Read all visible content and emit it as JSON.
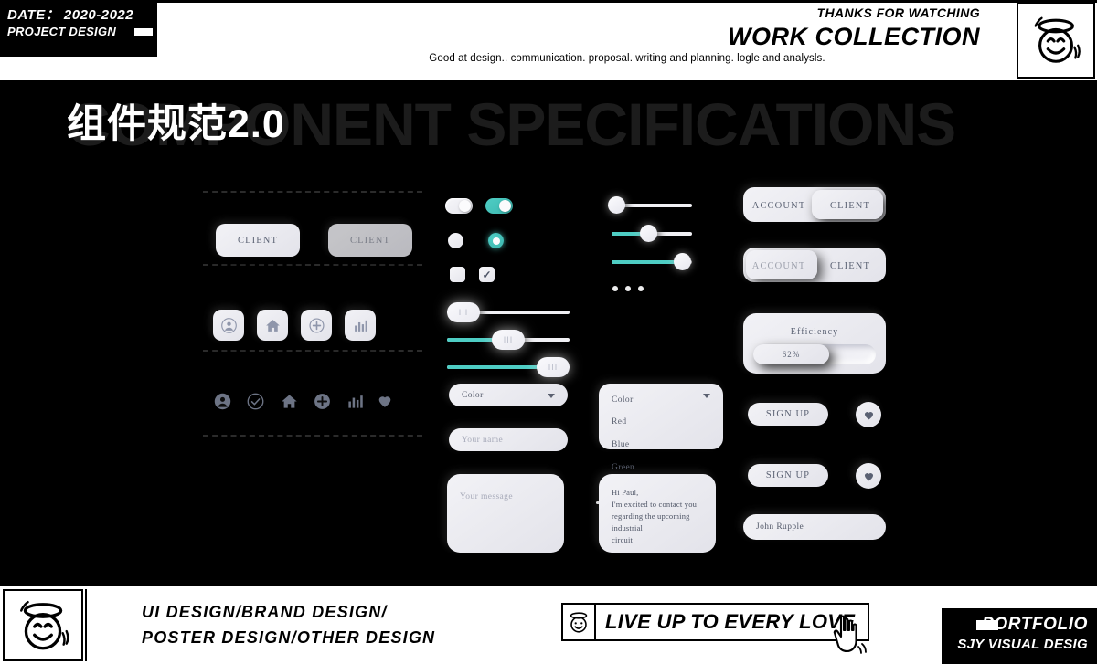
{
  "header": {
    "date_label": "DATE： 2020-2022",
    "project_label": "PROJECT DESIGN",
    "thanks": "THANKS FOR WATCHING",
    "title": "WORK COLLECTION",
    "subtitle": "Good at design..  communication.  proposal.  writing and planning.  logle and analysls.",
    "logo_icon": "angel-smiley-icon"
  },
  "hero": {
    "ghost_title": "COMPONENT SPECIFICATIONS",
    "cn_title": "组件规范2.0"
  },
  "colors": {
    "accent_teal": "#4ECDC4",
    "page_black": "#000000",
    "surface_light": "#ECECF1",
    "text_muted": "#5D6475"
  },
  "components": {
    "client_buttons": [
      {
        "label": "CLIENT",
        "state": "normal"
      },
      {
        "label": "CLIENT",
        "state": "soft"
      }
    ],
    "icon_square_buttons": [
      {
        "icon": "person-icon"
      },
      {
        "icon": "home-icon"
      },
      {
        "icon": "plus-circle-icon"
      },
      {
        "icon": "bar-chart-icon"
      }
    ],
    "plain_icons": [
      {
        "icon": "person-icon"
      },
      {
        "icon": "check-circle-icon"
      },
      {
        "icon": "home-icon"
      },
      {
        "icon": "plus-circle-icon"
      },
      {
        "icon": "bar-chart-icon"
      },
      {
        "icon": "heart-icon"
      }
    ],
    "toggles": [
      {
        "name": "toggle-off",
        "on": false
      },
      {
        "name": "toggle-on",
        "on": true
      }
    ],
    "radios": [
      {
        "name": "radio-off",
        "on": false
      },
      {
        "name": "radio-on",
        "on": true
      }
    ],
    "checkboxes": [
      {
        "name": "checkbox-off",
        "checked": false,
        "glyph": ""
      },
      {
        "name": "checkbox-checked",
        "checked": true,
        "glyph": "✓"
      }
    ],
    "pill_sliders": [
      {
        "value": 0,
        "handle_glyph": "III"
      },
      {
        "value": 50,
        "handle_glyph": "III"
      },
      {
        "value": 90,
        "handle_glyph": "III"
      }
    ],
    "round_sliders": [
      {
        "value": 0
      },
      {
        "value": 45
      },
      {
        "value": 88
      }
    ],
    "pagination_dots": 3,
    "spinners": 2,
    "segmented_controls": [
      {
        "options": [
          "ACCOUNT",
          "CLIENT"
        ],
        "selected": "CLIENT"
      },
      {
        "options": [
          "ACCOUNT",
          "CLIENT"
        ],
        "selected": "ACCOUNT"
      }
    ],
    "efficiency_card": {
      "title": "Efficiency",
      "progress_label": "62%",
      "progress_value": 62
    },
    "dropdown_closed": {
      "value": "Color",
      "caret": "chevron-down-icon"
    },
    "dropdown_open": {
      "value": "Color",
      "options": [
        "Red",
        "Blue",
        "Green"
      ],
      "caret": "chevron-down-icon"
    },
    "name_input": {
      "placeholder": "Your name",
      "value": ""
    },
    "message_empty": {
      "placeholder": "Your message",
      "value": ""
    },
    "message_filled": {
      "line1": "Hi Paul,",
      "line2": "I'm excited to contact you",
      "line3": "regarding the upcoming industrial",
      "line4": "circuit"
    },
    "signup_buttons": [
      {
        "label": "SIGN UP"
      },
      {
        "label": "SIGN UP"
      }
    ],
    "like_buttons": [
      {
        "icon": "heart-icon"
      },
      {
        "icon": "heart-icon"
      }
    ],
    "user_input": {
      "value": "John Rupple"
    }
  },
  "footer": {
    "logo_icon": "angel-smiley-icon",
    "line1": "UI DESIGN/BRAND DESIGN/",
    "line2": "POSTER DESIGN/OTHER DESIGN",
    "banner_icon": "angel-smiley-icon",
    "banner_text": "LIVE UP TO EVERY LOVE",
    "cursor_icon": "hand-cursor-icon",
    "portfolio": "PORTFOLIO",
    "studio": "SJY VISUAL DESIG"
  }
}
